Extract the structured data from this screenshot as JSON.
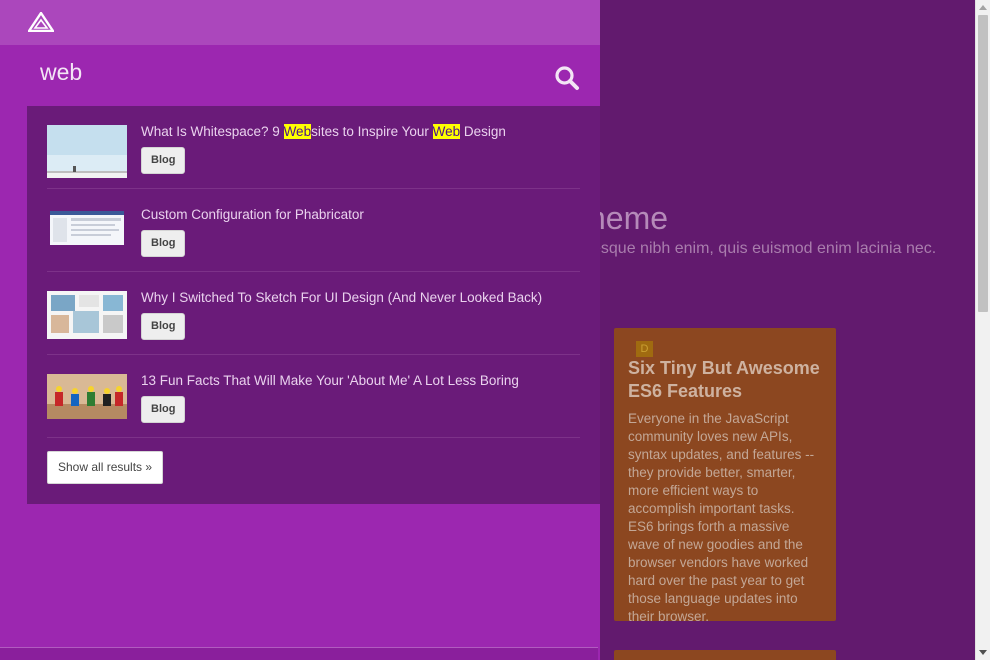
{
  "background": {
    "title_fragment": "heme",
    "subtitle_fragment": "esque nibh enim, quis euismod enim lacinia nec.",
    "card": {
      "badge": "D",
      "title": "Six Tiny But Awesome ES6 Features",
      "text": "Everyone in the JavaScript community loves new APIs, syntax updates, and features -- they provide better, smarter, more efficient ways to accomplish important tasks. ES6 brings forth a massive wave of new goodies and the browser vendors have worked hard over the past year to get those language updates into their browser."
    }
  },
  "search": {
    "query": "web",
    "icon": "search-icon"
  },
  "results": [
    {
      "title_parts": [
        "What Is Whitespace? 9 ",
        "Web",
        "sites to Inspire Your ",
        "Web",
        " Design"
      ],
      "tag": "Blog",
      "thumb": "whitespace-photo"
    },
    {
      "title_parts": [
        "Custom Configuration for Phabricator",
        "",
        "",
        "",
        ""
      ],
      "tag": "Blog",
      "thumb": "phabricator-screenshot"
    },
    {
      "title_parts": [
        "Why I Switched To Sketch For UI Design (And Never Looked Back)",
        "",
        "",
        "",
        ""
      ],
      "tag": "Blog",
      "thumb": "sketch-screenshot"
    },
    {
      "title_parts": [
        "13 Fun Facts That Will Make Your 'About Me' A Lot Less Boring",
        "",
        "",
        "",
        ""
      ],
      "tag": "Blog",
      "thumb": "lego-figures-photo"
    }
  ],
  "show_all_label": "Show all results »",
  "colors": {
    "panel": "#9c27b0",
    "results_bg": "#6a1b79",
    "highlight": "#ffff00",
    "page_bg": "#621a6e",
    "card": "#8c4720"
  }
}
